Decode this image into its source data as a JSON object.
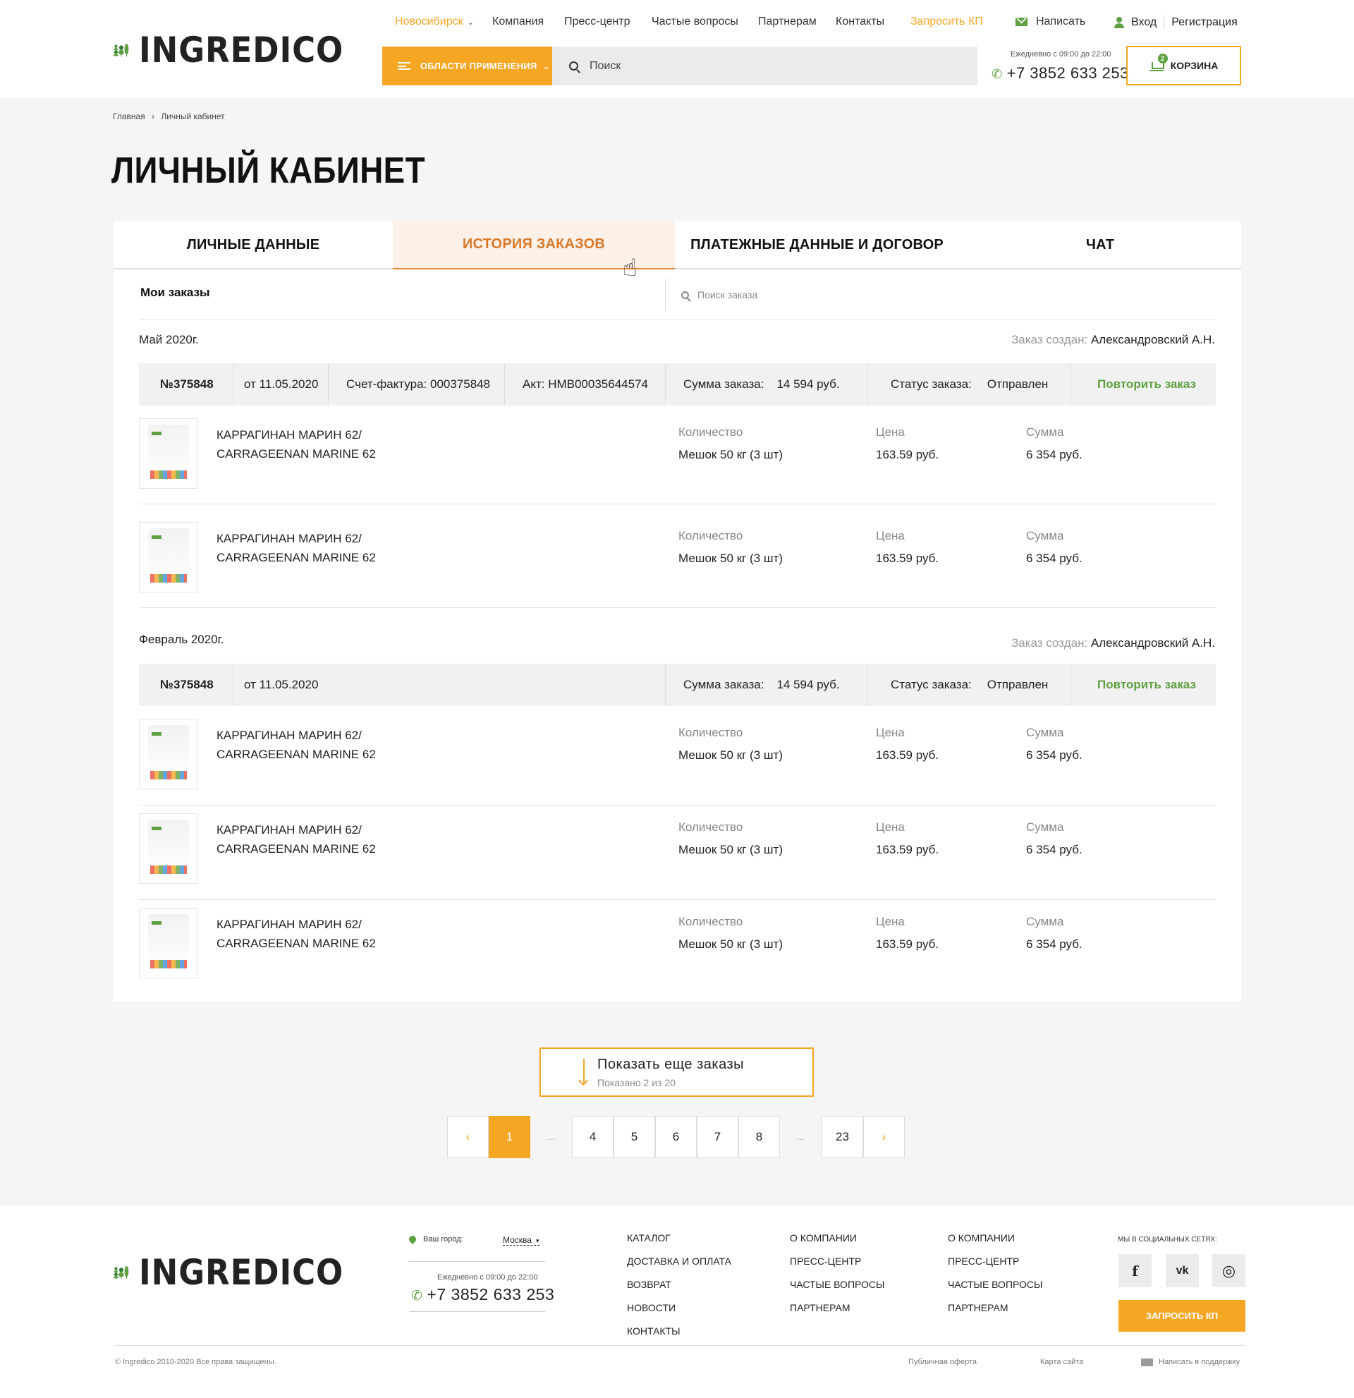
{
  "brand": {
    "name": "INGREDICO"
  },
  "header": {
    "city": "Новосибирск",
    "nav": [
      "Компания",
      "Пресс-центр",
      "Частые вопросы",
      "Партнерам",
      "Контакты"
    ],
    "request_kp": "Запросить КП",
    "write": "Написать",
    "login": "Вход",
    "register": "Регистрация",
    "areas_label": "ОБЛАСТИ ПРИМЕНЕНИЯ",
    "search_placeholder": "Поиск",
    "hours": "Ежедневно с 09:00 до 22:00",
    "phone": "+7 3852 633 253",
    "cart_label": "КОРЗИНА",
    "cart_count": "2"
  },
  "breadcrumb": {
    "home": "Главная",
    "sep": "›",
    "current": "Личный кабинет"
  },
  "page_title": "ЛИЧНЫЙ КАБИНЕТ",
  "tabs": [
    {
      "label": "ЛИЧНЫЕ ДАННЫЕ",
      "active": false
    },
    {
      "label": "ИСТОРИЯ ЗАКАЗОВ",
      "active": true
    },
    {
      "label": "ПЛАТЕЖНЫЕ ДАННЫЕ И ДОГОВОР",
      "active": false
    },
    {
      "label": "ЧАТ",
      "active": false
    }
  ],
  "orders": {
    "title": "Мои заказы",
    "search_placeholder": "Поиск заказа",
    "created_label": "Заказ создан:",
    "created_by": "Александровский А.Н.",
    "sum_label": "Сумма заказа:",
    "status_label": "Статус заказа:",
    "repeat_label": "Повторить заказ",
    "qty_label": "Количество",
    "price_label": "Цена",
    "total_label": "Сумма",
    "groups": [
      {
        "month": "Май 2020г.",
        "number": "№375848",
        "date": "от 11.05.2020",
        "invoice": "Счет-фактура: 000375848",
        "act": "Акт: HMB00035644574",
        "sum": "14 594 руб.",
        "status": "Отправлен",
        "items": [
          {
            "name": "КАРРАГИНАН МАРИН 62/ CARRAGEENAN MARINE 62",
            "qty": "Мешок 50 кг (3 шт)",
            "price": "163.59 руб.",
            "total": "6 354 руб."
          },
          {
            "name": "КАРРАГИНАН МАРИН 62/ CARRAGEENAN MARINE 62",
            "qty": "Мешок 50 кг (3 шт)",
            "price": "163.59 руб.",
            "total": "6 354 руб."
          }
        ]
      },
      {
        "month": "Февраль 2020г.",
        "number": "№375848",
        "date": "от 11.05.2020",
        "sum": "14 594 руб.",
        "status": "Отправлен",
        "items": [
          {
            "name": "КАРРАГИНАН МАРИН 62/ CARRAGEENAN MARINE 62",
            "qty": "Мешок 50 кг (3 шт)",
            "price": "163.59 руб.",
            "total": "6 354 руб."
          },
          {
            "name": "КАРРАГИНАН МАРИН 62/ CARRAGEENAN MARINE 62",
            "qty": "Мешок 50 кг (3 шт)",
            "price": "163.59 руб.",
            "total": "6 354 руб."
          },
          {
            "name": "КАРРАГИНАН МАРИН 62/ CARRAGEENAN MARINE 62",
            "qty": "Мешок 50 кг (3 шт)",
            "price": "163.59 руб.",
            "total": "6 354 руб."
          }
        ]
      }
    ]
  },
  "load_more": {
    "label": "Показать еще заказы",
    "shown": "Показано 2 из 20"
  },
  "pagination": {
    "prev": "‹",
    "next": "›",
    "dots": "...",
    "pages": [
      "1",
      "4",
      "5",
      "6",
      "7",
      "8",
      "23"
    ],
    "current": "1"
  },
  "footer": {
    "city_label": "Ваш город:",
    "city": "Москва",
    "hours": "Ежедневно с 09:00 до 22:00",
    "phone": "+7 3852 633 253",
    "col1": [
      "КАТАЛОГ",
      "ДОСТАВКА И ОПЛАТА",
      "ВОЗВРАТ",
      "НОВОСТИ",
      "КОНТАКТЫ"
    ],
    "col2": [
      "О КОМПАНИИ",
      "ПРЕСС-ЦЕНТР",
      "ЧАСТЫЕ ВОПРОСЫ",
      "ПАРТНЕРАМ"
    ],
    "col3": [
      "О КОМПАНИИ",
      "ПРЕСС-ЦЕНТР",
      "ЧАСТЫЕ ВОПРОСЫ",
      "ПАРТНЕРАМ"
    ],
    "social_title": "МЫ В СОЦИАЛЬНЫХ СЕТЯХ:",
    "socials": [
      {
        "icon": "facebook-icon",
        "glyph": "f"
      },
      {
        "icon": "vk-icon",
        "glyph": "vk"
      },
      {
        "icon": "instagram-icon",
        "glyph": "◎"
      }
    ],
    "request_kp": "ЗАПРОСИТЬ КП",
    "copyright": "© Ingredico 2010-2020 Все права защищены.",
    "offer": "Публичная оферта",
    "sitemap": "Карта сайта",
    "support": "Написать в поддержку"
  },
  "colors": {
    "accent": "#f5a623",
    "green": "#5fa041",
    "tab_active": "#d9782a"
  }
}
